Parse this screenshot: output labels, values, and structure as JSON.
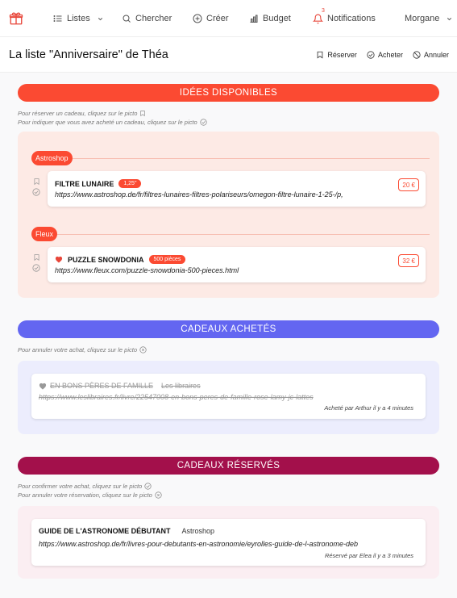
{
  "nav": {
    "lists_label": "Listes",
    "search_label": "Chercher",
    "create_label": "Créer",
    "budget_label": "Budget",
    "notifications_label": "Notifications",
    "notifications_count": "3",
    "user_label": "Morgane"
  },
  "page": {
    "title": "La liste \"Anniversaire\" de Théa",
    "reserve_label": "Réserver",
    "buy_label": "Acheter",
    "cancel_label": "Annuler"
  },
  "colors": {
    "available": "#fb4a32",
    "bought": "#6366f1",
    "reserved": "#a3104b"
  },
  "available": {
    "header": "IDÉES DISPONIBLES",
    "hint1": "Pour réserver un cadeau, cliquez sur le picto",
    "hint2": "Pour indiquer que vous avez acheté un cadeau, cliquez sur le picto",
    "groups": [
      {
        "shop": "Astroshop",
        "item": {
          "title": "FILTRE LUNAIRE",
          "badge": "1,25\"",
          "url": "https://www.astroshop.de/fr/filtres-lunaires-filtres-polariseurs/omegon-filtre-lunaire-1-25-/p,",
          "price": "20 €"
        }
      },
      {
        "shop": "Fleux",
        "item": {
          "title": "PUZZLE SNOWDONIA",
          "badge": "500 pièces",
          "url": "https://www.fleux.com/puzzle-snowdonia-500-pieces.html",
          "price": "32 €",
          "favorite_icon": "heart-icon"
        }
      }
    ]
  },
  "bought": {
    "header": "CADEAUX ACHETÉS",
    "hint": "Pour annuler votre achat, cliquez sur le picto",
    "item": {
      "title": "EN BONS PÈRES DE FAMILLE",
      "shop": "Les libraires",
      "url": "https://www.leslibraires.fr/livre/22547008-en-bons-peres-de-famille-rose-lamy-jc-lattes",
      "meta": "Acheté par Arthur il y a 4 minutes"
    }
  },
  "reserved": {
    "header": "CADEAUX RÉSERVÉS",
    "hint1": "Pour confirmer votre achat, cliquez sur le picto",
    "hint2": "Pour annuler votre réservation, cliquez sur le picto",
    "item": {
      "title": "GUIDE DE L'ASTRONOME DÉBUTANT",
      "shop": "Astroshop",
      "url": "https://www.astroshop.de/fr/livres-pour-debutants-en-astronomie/eyrolles-guide-de-l-astronome-deb",
      "meta": "Réservé par Elea il y a 3 minutes"
    }
  }
}
